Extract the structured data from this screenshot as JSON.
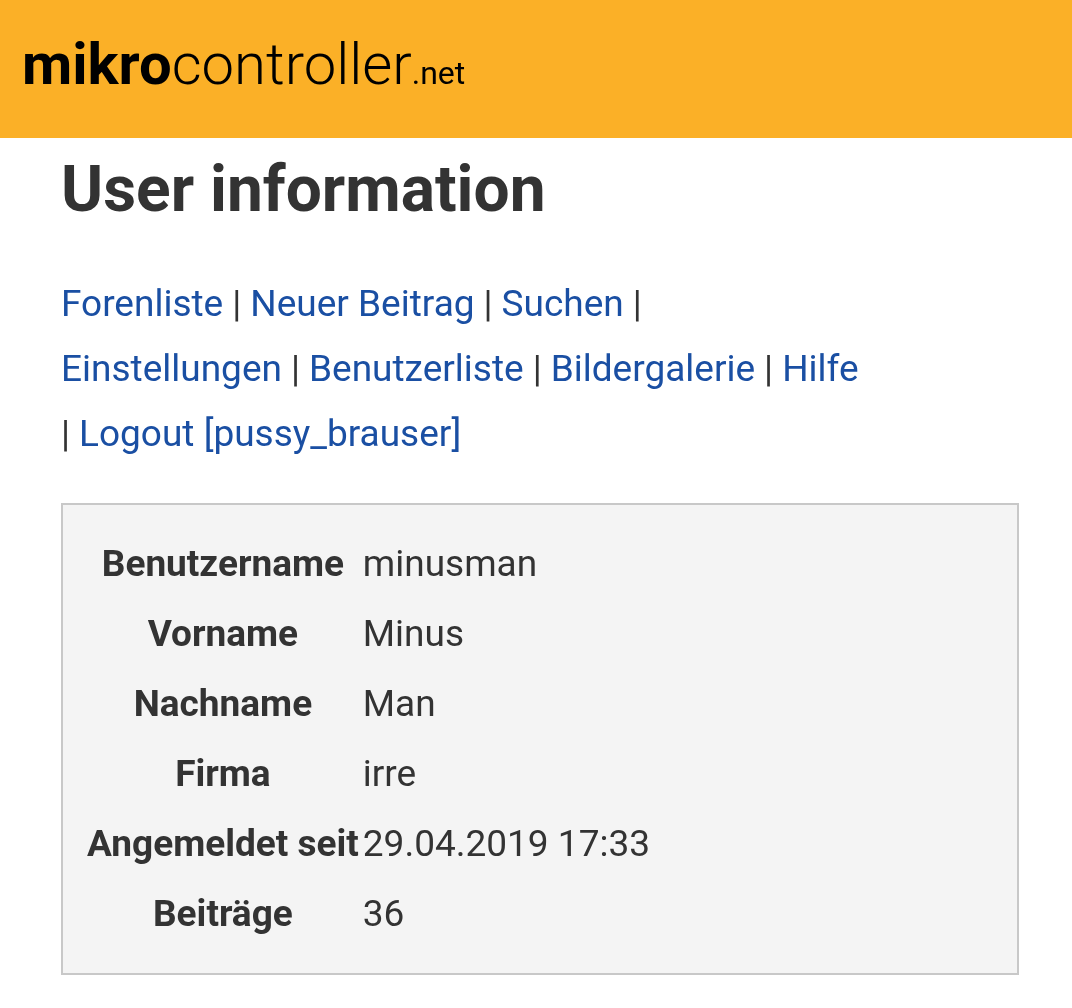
{
  "header": {
    "logo": {
      "part_1": "mikro",
      "part_2": "controller",
      "part_3": ".net"
    }
  },
  "title": "User information",
  "nav_lines": [
    [
      {
        "kind": "link",
        "text": "Forenliste"
      },
      {
        "kind": "separator",
        "text": "|"
      },
      {
        "kind": "link",
        "text": "Neuer Beitrag"
      },
      {
        "kind": "separator",
        "text": "|"
      },
      {
        "kind": "link",
        "text": "Suchen"
      },
      {
        "kind": "separator",
        "text": "|"
      }
    ],
    [
      {
        "kind": "link",
        "text": "Einstellungen"
      },
      {
        "kind": "separator",
        "text": "|"
      },
      {
        "kind": "link",
        "text": "Benutzerliste"
      },
      {
        "kind": "separator",
        "text": "|"
      },
      {
        "kind": "link",
        "text": "Bildergalerie"
      },
      {
        "kind": "separator",
        "text": "|"
      },
      {
        "kind": "link",
        "text": "Hilfe"
      }
    ],
    [
      {
        "kind": "separator",
        "text": "|"
      },
      {
        "kind": "link",
        "text": "Logout [pussy_brauser]"
      }
    ]
  ],
  "user_table": [
    {
      "label": "Benutzername",
      "value": "minusman"
    },
    {
      "label": "Vorname",
      "value": "Minus"
    },
    {
      "label": "Nachname",
      "value": "Man"
    },
    {
      "label": "Firma",
      "value": "irre"
    },
    {
      "label": "Angemeldet seit",
      "value": "29.04.2019 17:33"
    },
    {
      "label": "Beiträge",
      "value": "36"
    }
  ]
}
